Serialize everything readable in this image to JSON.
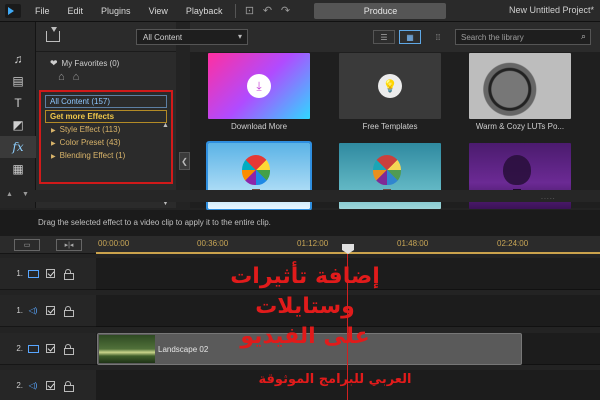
{
  "app": {
    "menu": [
      "File",
      "Edit",
      "Plugins",
      "View",
      "Playback"
    ],
    "produce_label": "Produce",
    "project_title": "New Untitled Project*"
  },
  "rail": {
    "items": [
      "media-icon",
      "title-icon",
      "text-icon",
      "transition-icon",
      "fx-icon",
      "particle-icon"
    ],
    "fx_label": "fx",
    "text_label": "T"
  },
  "library": {
    "favorites": "My Favorites (0)",
    "tree": {
      "all_content": "All Content (157)",
      "get_more": "Get more Effects",
      "style_effect": "Style Effect  (113)",
      "color_preset": "Color Preset  (43)",
      "blending_effect": "Blending Effect  (1)"
    }
  },
  "content": {
    "dropdown_value": "All Content",
    "search_placeholder": "Search the library",
    "tiles": [
      {
        "label": "Download More"
      },
      {
        "label": "Free Templates"
      },
      {
        "label": "Warm & Cozy LUTs Po..."
      },
      {
        "label": ""
      },
      {
        "label": ""
      },
      {
        "label": ""
      }
    ]
  },
  "hint": "Drag the selected effect to a video clip to apply it to the entire clip.",
  "timeline": {
    "ticks": [
      "00:00:00",
      "00:36:00",
      "01:12:00",
      "01:48:00",
      "02:24:00"
    ],
    "tracks": [
      {
        "number": "1.",
        "kind": "video"
      },
      {
        "number": "1.",
        "kind": "audio"
      },
      {
        "number": "2.",
        "kind": "video"
      },
      {
        "number": "2.",
        "kind": "audio"
      }
    ],
    "clip_label": "Landscape 02"
  },
  "overlay": {
    "title_line1": "إضافة تأثيرات وستايلات",
    "title_line2": "على الفيديو",
    "footer": "العربي للبرامج الموثوقة"
  },
  "colors": {
    "accent_blue": "#58a6ff",
    "highlight_red": "#e11b1b",
    "ruler_gold": "#caa24c"
  }
}
